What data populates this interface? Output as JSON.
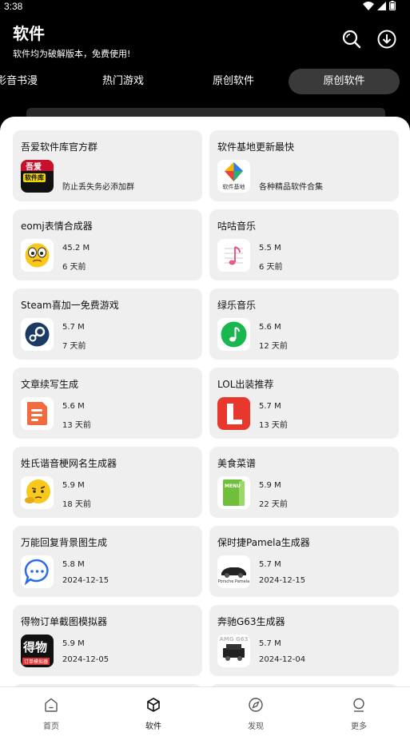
{
  "status": {
    "time": "3:38"
  },
  "header": {
    "title": "软件",
    "subtitle": "软件均为破解版本，免费使用!"
  },
  "tabs": [
    {
      "label": "影音书漫"
    },
    {
      "label": "热门游戏"
    },
    {
      "label": "原创软件"
    },
    {
      "label": "原创软件",
      "active": true
    }
  ],
  "cards": [
    {
      "name": "吾爱软件库官方群",
      "desc": "防止丢失务必添加群",
      "icon": "wuai-software-library-icon"
    },
    {
      "name": "软件基地更新最快",
      "desc": "各种精品软件合集",
      "icon": "software-base-icon"
    },
    {
      "name": "eomj表情合成器",
      "size": "45.2 M",
      "date": "6 天前",
      "icon": "emoji-face-icon"
    },
    {
      "name": "咕咕音乐",
      "size": "5.5 M",
      "date": "6 天前",
      "icon": "music-note-icon"
    },
    {
      "name": "Steam喜加一免费游戏",
      "size": "5.7 M",
      "date": "7 天前",
      "icon": "steam-icon"
    },
    {
      "name": "绿乐音乐",
      "size": "5.6 M",
      "date": "12 天前",
      "icon": "green-music-icon"
    },
    {
      "name": "文章续写生成",
      "size": "5.6 M",
      "date": "13 天前",
      "icon": "document-icon"
    },
    {
      "name": "LOL出装推荐",
      "size": "5.7 M",
      "date": "13 天前",
      "icon": "lol-l-icon"
    },
    {
      "name": "姓氏谐音梗网名生成器",
      "size": "5.9 M",
      "date": "18 天前",
      "icon": "thinking-face-icon"
    },
    {
      "name": "美食菜谱",
      "size": "5.9 M",
      "date": "22 天前",
      "icon": "menu-book-icon"
    },
    {
      "name": "万能回复背景图生成",
      "size": "5.8 M",
      "date": "2024-12-15",
      "icon": "chat-bubble-icon"
    },
    {
      "name": "保时捷Pamela生成器",
      "size": "5.7 M",
      "date": "2024-12-15",
      "icon": "porsche-car-icon",
      "icon_text": "Porsche Pamela"
    },
    {
      "name": "得物订单截图模拟器",
      "size": "5.9 M",
      "date": "2024-12-05",
      "icon": "dewu-icon",
      "icon_text": "得物",
      "icon_subtext": "订单模拟器"
    },
    {
      "name": "奔驰G63生成器",
      "size": "5.7 M",
      "date": "2024-12-04",
      "icon": "g63-car-icon",
      "icon_text": "AMG G63"
    }
  ],
  "icon_text": {
    "wuai_top": "吾爱",
    "wuai_mid": "软件库",
    "base_label": "软件基地",
    "menu": "MENU"
  },
  "nav": [
    {
      "label": "首页"
    },
    {
      "label": "软件",
      "active": true
    },
    {
      "label": "发现"
    },
    {
      "label": "更多"
    }
  ]
}
